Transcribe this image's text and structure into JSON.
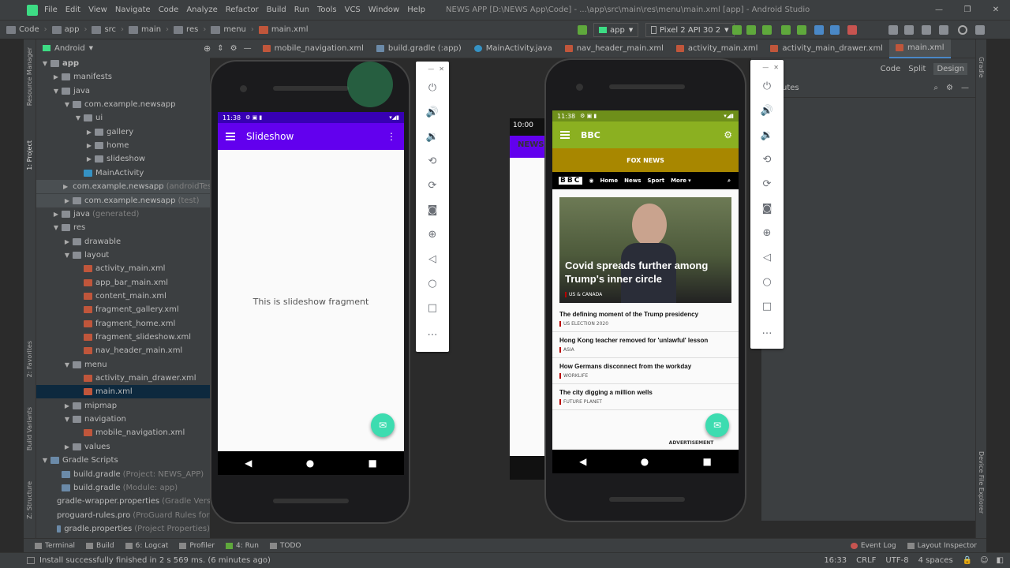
{
  "menubar": {
    "items": [
      "File",
      "Edit",
      "View",
      "Navigate",
      "Code",
      "Analyze",
      "Refactor",
      "Build",
      "Run",
      "Tools",
      "VCS",
      "Window",
      "Help"
    ],
    "title": "NEWS APP [D:\\NEWS App\\Code] - ...\\app\\src\\main\\res\\menu\\main.xml [app] - Android Studio"
  },
  "breadcrumb": [
    "Code",
    "app",
    "src",
    "main",
    "res",
    "menu",
    "main.xml"
  ],
  "toolbar": {
    "run_config": "app",
    "device": "Pixel 2 API 30 2"
  },
  "leftstrip": {
    "project": "1: Project",
    "resource_manager": "Resource Manager",
    "favorites": "2: Favorites",
    "build_variants": "Build Variants",
    "structure": "Z: Structure"
  },
  "rightstrip": {
    "gradle": "Gradle",
    "device_file_explorer": "Device File Explorer"
  },
  "project_panel": {
    "view": "Android"
  },
  "tree": [
    {
      "label": "app",
      "depth": 0,
      "arrow": "▼",
      "icon": "folder",
      "bold": true
    },
    {
      "label": "manifests",
      "depth": 1,
      "arrow": "▶",
      "icon": "folder"
    },
    {
      "label": "java",
      "depth": 1,
      "arrow": "▼",
      "icon": "folder"
    },
    {
      "label": "com.example.newsapp",
      "depth": 2,
      "arrow": "▼",
      "icon": "folder"
    },
    {
      "label": "ui",
      "depth": 3,
      "arrow": "▼",
      "icon": "folder"
    },
    {
      "label": "gallery",
      "depth": 4,
      "arrow": "▶",
      "icon": "folder"
    },
    {
      "label": "home",
      "depth": 4,
      "arrow": "▶",
      "icon": "folder"
    },
    {
      "label": "slideshow",
      "depth": 4,
      "arrow": "▶",
      "icon": "folder"
    },
    {
      "label": "MainActivity",
      "depth": 3,
      "arrow": "",
      "icon": "java"
    },
    {
      "label": "com.example.newsapp",
      "depth": 2,
      "arrow": "▶",
      "icon": "folder",
      "dim": "(androidTest)",
      "hl": true
    },
    {
      "label": "com.example.newsapp",
      "depth": 2,
      "arrow": "▶",
      "icon": "folder",
      "dim": "(test)",
      "hl": true
    },
    {
      "label": "java",
      "depth": 1,
      "arrow": "▶",
      "icon": "folder",
      "dim": "(generated)"
    },
    {
      "label": "res",
      "depth": 1,
      "arrow": "▼",
      "icon": "folder"
    },
    {
      "label": "drawable",
      "depth": 2,
      "arrow": "▶",
      "icon": "folder"
    },
    {
      "label": "layout",
      "depth": 2,
      "arrow": "▼",
      "icon": "folder"
    },
    {
      "label": "activity_main.xml",
      "depth": 3,
      "arrow": "",
      "icon": "xml"
    },
    {
      "label": "app_bar_main.xml",
      "depth": 3,
      "arrow": "",
      "icon": "xml"
    },
    {
      "label": "content_main.xml",
      "depth": 3,
      "arrow": "",
      "icon": "xml"
    },
    {
      "label": "fragment_gallery.xml",
      "depth": 3,
      "arrow": "",
      "icon": "xml"
    },
    {
      "label": "fragment_home.xml",
      "depth": 3,
      "arrow": "",
      "icon": "xml"
    },
    {
      "label": "fragment_slideshow.xml",
      "depth": 3,
      "arrow": "",
      "icon": "xml"
    },
    {
      "label": "nav_header_main.xml",
      "depth": 3,
      "arrow": "",
      "icon": "xml"
    },
    {
      "label": "menu",
      "depth": 2,
      "arrow": "▼",
      "icon": "folder"
    },
    {
      "label": "activity_main_drawer.xml",
      "depth": 3,
      "arrow": "",
      "icon": "xml"
    },
    {
      "label": "main.xml",
      "depth": 3,
      "arrow": "",
      "icon": "xml",
      "sel": true
    },
    {
      "label": "mipmap",
      "depth": 2,
      "arrow": "▶",
      "icon": "folder"
    },
    {
      "label": "navigation",
      "depth": 2,
      "arrow": "▼",
      "icon": "folder"
    },
    {
      "label": "mobile_navigation.xml",
      "depth": 3,
      "arrow": "",
      "icon": "xml"
    },
    {
      "label": "values",
      "depth": 2,
      "arrow": "▶",
      "icon": "folder"
    },
    {
      "label": "Gradle Scripts",
      "depth": 0,
      "arrow": "▼",
      "icon": "gradle"
    },
    {
      "label": "build.gradle",
      "depth": 1,
      "arrow": "",
      "icon": "gradle",
      "dim": "(Project: NEWS_APP)"
    },
    {
      "label": "build.gradle",
      "depth": 1,
      "arrow": "",
      "icon": "gradle",
      "dim": "(Module: app)"
    },
    {
      "label": "gradle-wrapper.properties",
      "depth": 1,
      "arrow": "",
      "icon": "gradle",
      "dim": "(Gradle Versi"
    },
    {
      "label": "proguard-rules.pro",
      "depth": 1,
      "arrow": "",
      "icon": "gradle",
      "dim": "(ProGuard Rules for ap"
    },
    {
      "label": "gradle.properties",
      "depth": 1,
      "arrow": "",
      "icon": "gradle",
      "dim": "(Project Properties)"
    }
  ],
  "tabs": [
    {
      "label": "mobile_navigation.xml",
      "icon": "xml"
    },
    {
      "label": "build.gradle (:app)",
      "icon": "gradle"
    },
    {
      "label": "MainActivity.java",
      "icon": "java"
    },
    {
      "label": "nav_header_main.xml",
      "icon": "xml"
    },
    {
      "label": "activity_main.xml",
      "icon": "xml"
    },
    {
      "label": "activity_main_drawer.xml",
      "icon": "xml"
    },
    {
      "label": "main.xml",
      "icon": "xml",
      "active": true
    }
  ],
  "design_modes": [
    "Code",
    "Split",
    "Design"
  ],
  "attributes_label": "utes",
  "phone1": {
    "time": "11:38",
    "app_title": "Slideshow",
    "content": "This is slideshow fragment",
    "appbar_color": "#6200ee",
    "status_color": "#3700b3"
  },
  "phone2": {
    "time": "11:38",
    "app_title": "BBC",
    "subheader": "FOX NEWS",
    "appbar_color": "#8bb021",
    "subheader_color": "#a88700",
    "bbc_nav": [
      "Home",
      "News",
      "Sport",
      "More"
    ],
    "headline": "Covid spreads further among Trump's inner circle",
    "headline_tag": "US & CANADA",
    "stories": [
      {
        "title": "The defining moment of the Trump presidency",
        "tag": "US ELECTION 2020"
      },
      {
        "title": "Hong Kong teacher removed for 'unlawful' lesson",
        "tag": "ASIA"
      },
      {
        "title": "How Germans disconnect from the workday",
        "tag": "WORKLIFE"
      },
      {
        "title": "The city digging a million wells",
        "tag": "FUTURE PLANET"
      }
    ],
    "ad_label": "ADVERTISEMENT"
  },
  "bg_device": {
    "time": "10:00",
    "label": "NEWS"
  },
  "bottom_tools": [
    "Terminal",
    "Build",
    "6: Logcat",
    "Profiler",
    "4: Run",
    "TODO"
  ],
  "bottom_right_tools": [
    "Event Log",
    "Layout Inspector"
  ],
  "status": {
    "message": "Install successfully finished in 2 s 569 ms. (6 minutes ago)",
    "position": "16:33",
    "line_sep": "CRLF",
    "encoding": "UTF-8",
    "indent": "4 spaces"
  }
}
